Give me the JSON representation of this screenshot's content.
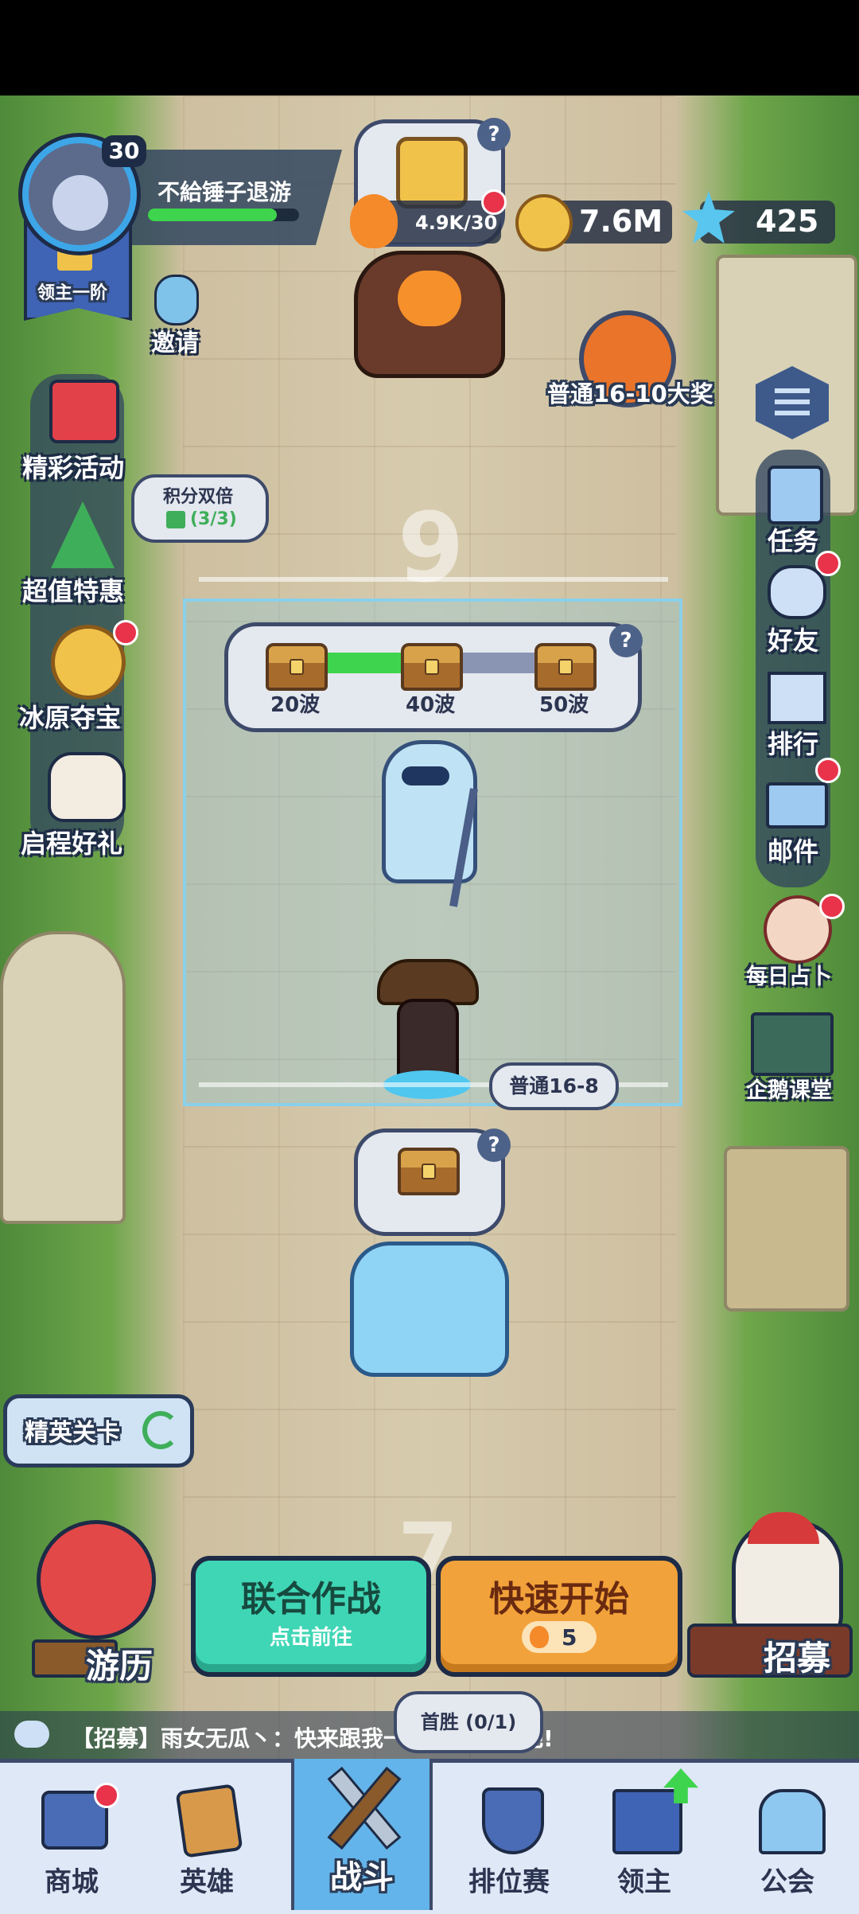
{
  "player": {
    "level": "30",
    "name": "不給锤子退游",
    "rank_label": "领主一阶",
    "exp_progress": 0.85
  },
  "resources": {
    "stamina": "4.9K/30",
    "gold": "7.6M",
    "gems": "425"
  },
  "invite_label": "邀请",
  "grand_prize_label": "普通16-10大奖",
  "left_menu": [
    {
      "label": "精彩活动",
      "icon": "gift-icon"
    },
    {
      "label": "超值特惠",
      "icon": "tree-icon"
    },
    {
      "label": "冰原夺宝",
      "icon": "coin-icon"
    },
    {
      "label": "启程好礼",
      "icon": "fox-icon"
    }
  ],
  "points_double": {
    "title": "积分双倍",
    "count": "(3/3)"
  },
  "right_menu": [
    {
      "label": "任务",
      "icon": "clipboard-icon"
    },
    {
      "label": "好友",
      "icon": "friends-icon"
    },
    {
      "label": "排行",
      "icon": "podium-icon"
    },
    {
      "label": "邮件",
      "icon": "mail-icon"
    }
  ],
  "daily_fortune_label": "每日占卜",
  "penguin_class_label": "企鹅课堂",
  "stage_number_top": "9",
  "wave_rewards": [
    "20波",
    "40波",
    "50波"
  ],
  "wave_progress": 0.6,
  "current_stage_label": "普通16-8",
  "elite_stage_label": "精英关卡",
  "bottom_stage_number": "7",
  "travel_label": "游历",
  "coop_button": {
    "title": "联合作战",
    "subtitle": "点击前往"
  },
  "quick_start_button": {
    "title": "快速开始",
    "cost": "5"
  },
  "recruit_label": "招募",
  "first_win_label": "首胜 (0/1)",
  "chat_message": "【招募】雨女无瓜丶：快来跟我一",
  "chat_message_tail": "吧!",
  "bottom_nav": [
    {
      "label": "商城",
      "icon": "shop-icon"
    },
    {
      "label": "英雄",
      "icon": "hero-card-icon"
    },
    {
      "label": "战斗",
      "icon": "battle-swords-icon"
    },
    {
      "label": "排位赛",
      "icon": "ranked-shield-icon"
    },
    {
      "label": "领主",
      "icon": "lord-banner-icon"
    },
    {
      "label": "公会",
      "icon": "guild-castle-icon"
    }
  ],
  "colors": {
    "accent_green": "#3fd6b5",
    "accent_orange": "#f2a23a",
    "nav_bg": "#dfe8f7",
    "dark_navy": "#2a3a5a"
  }
}
